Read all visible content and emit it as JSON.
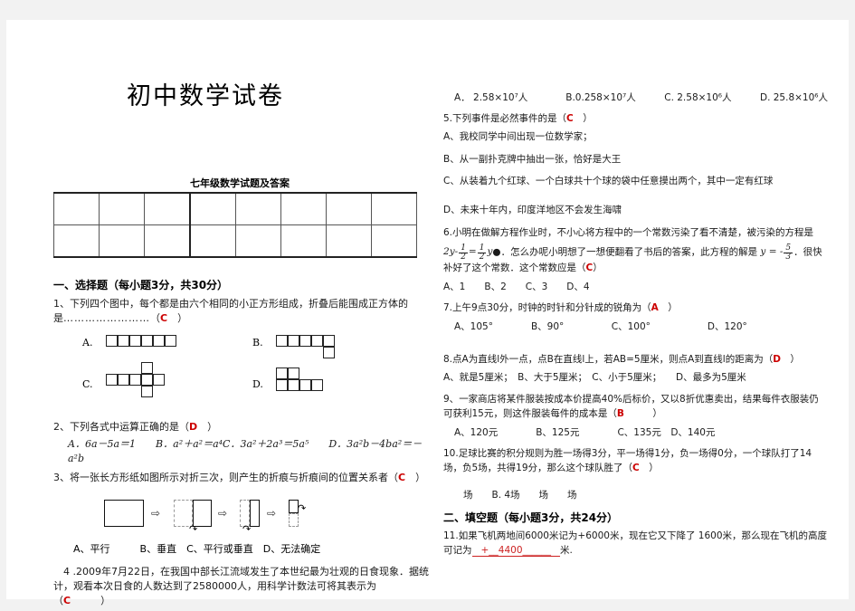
{
  "document": {
    "title": "初中数学试卷",
    "subtitle": "七年级数学试题及答案"
  },
  "answer_grid": {
    "columns": 8,
    "rows": 2,
    "cells": [
      "",
      "",
      "",
      "",
      "",
      "",
      "",
      "",
      "",
      "",
      "",
      "",
      "",
      "",
      "",
      ""
    ]
  },
  "section_one": {
    "heading": "一、选择题（每小题3分，共30分）",
    "questions": [
      {
        "number": "1、",
        "text": "下列四个图中，每个都是由六个相同的小正方形组成，折叠后能围成正方体的是",
        "dots": "……………………",
        "answer": "C",
        "option_labels": [
          "A.",
          "B.",
          "C.",
          "D."
        ]
      },
      {
        "number": "2、",
        "text": "下列各式中运算正确的是（",
        "answer": "D",
        "options_inline": "A．6a－5a＝1　　B．a²＋a²＝a⁴C．3a²＋2a³＝5a⁵　　D．3a²b－4ba²＝－a²b"
      },
      {
        "number": "3、",
        "text": "将一张长方形纸如图所示对折三次，则产生的折痕与折痕间的位置关系者（",
        "answer": "C",
        "options_inline": "A、平行　　　B、垂直　C、平行或垂直　D、无法确定"
      },
      {
        "number": "4 .",
        "text": "2009年7月22日，在我国中部长江流域发生了本世纪最为壮观的日食现象．据统计，观看本次日食的人数达到了2580000人，用科学计数法可将其表示为（",
        "answer": "C",
        "options_inline": "A． 2.58×10⁷人　　　　B.0.258×10⁷人　　　C. 2.58×10⁶人　　　D. 25.8×10⁶人"
      },
      {
        "number": "5.",
        "text": "下列事件是必然事件的是（",
        "answer": "C",
        "options_block": [
          "A、我校同学中间出现一位数学家；",
          "B、从一副扑克牌中抽出一张，恰好是大王",
          "C、从装着九个红球、一个白球共十个球的袋中任意摸出两个，其中一定有红球",
          "D、未来十年内，印度洋地区不会发生海啸"
        ]
      },
      {
        "number": "6.",
        "text_a": "小明在做解方程作业时，不小心将方程中的一个常数污染了看不清楚，被污染的方程是",
        "equation_pre": "2",
        "equation_mid": "．怎么办呢小明想了一想便翻看了书后的答案，此方程的解是",
        "equation_post": "．很快补好了这个常数．这个常数应是",
        "answer": "C",
        "options_inline": "A、1　　B、2　　C、3　　D、4"
      },
      {
        "number": "7.",
        "text": "上午9点30分，时钟的时针和分针成的锐角为（",
        "answer": "A",
        "options_inline": "A、105°　　　　B、90°　　　　　C、100°　　　　　　D、120°"
      },
      {
        "number": "8.",
        "text": "点A为直线l外一点，点B在直线l上，若AB=5厘米，则点A到直线l的距离为（",
        "answer": "D",
        "options_inline": "A、就是5厘米；　B、大于5厘米；　C、小于5厘米；　　D、最多为5厘米"
      },
      {
        "number": "9、",
        "text": "一家商店将某件服装按成本价提高40%后标价，又以8折优惠卖出，结果每件衣服装仍可获利15元，则这件服装每件的成本是（",
        "answer": "B",
        "options_inline": "A、120元　　　　B、125元　　　　C、135元　D、140元"
      },
      {
        "number": "10.",
        "text": "足球比赛的积分规则为胜一场得3分，平一场得1分，负一场得0分，一个球队打了14场，负5场，共得19分，那么这个球队胜了（",
        "answer": "C",
        "options_faded": "场　　B. 4场　　场　　场"
      }
    ]
  },
  "section_two": {
    "heading": "二、填空题（每小题3分，共24分）",
    "questions": [
      {
        "number": "11.",
        "text_a": "如果飞机两地间6000米记为+6000米，现在它又下降了 1600米，那么现在飞机的高度可记为",
        "blank_answer": "+__4400______",
        "text_b": "米."
      }
    ]
  },
  "equation6": {
    "lhs_coef": "2",
    "var": "y",
    "frac1_num": "1",
    "frac1_den": "2",
    "eq": "=",
    "frac2_num": "1",
    "frac2_den": "2",
    "var2": "y",
    "blot": "●",
    "solution_var": "y",
    "solution_eq": "= -",
    "sol_num": "5",
    "sol_den": "3"
  }
}
